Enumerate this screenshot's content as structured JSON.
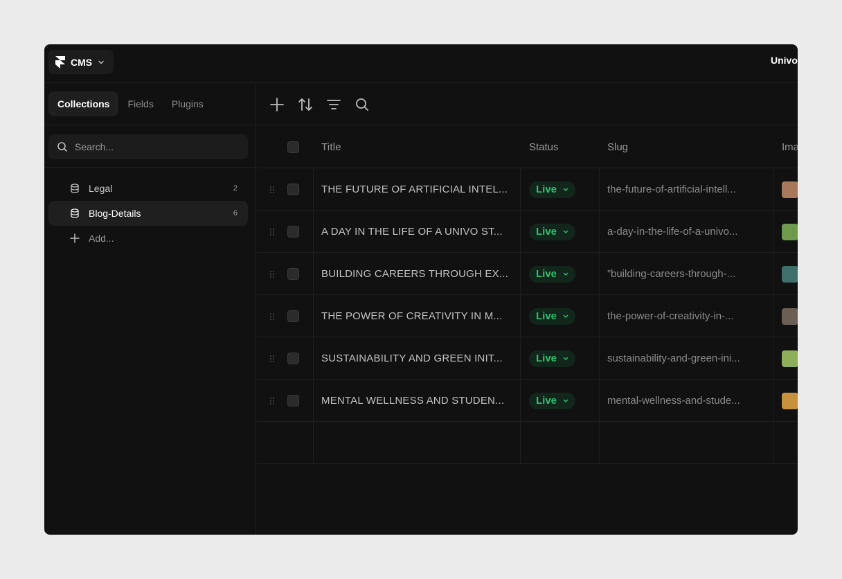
{
  "app": {
    "menu_label": "CMS",
    "project_name": "Univo"
  },
  "sidebar": {
    "tabs": [
      {
        "label": "Collections",
        "active": true
      },
      {
        "label": "Fields",
        "active": false
      },
      {
        "label": "Plugins",
        "active": false
      }
    ],
    "search_placeholder": "Search...",
    "collections": [
      {
        "label": "Legal",
        "count": "2",
        "active": false
      },
      {
        "label": "Blog-Details",
        "count": "6",
        "active": true
      }
    ],
    "add_label": "Add..."
  },
  "toolbar": {
    "icons": [
      "plus-icon",
      "sort-icon",
      "filter-icon",
      "search-icon"
    ]
  },
  "table": {
    "columns": [
      "Title",
      "Status",
      "Slug",
      "Image"
    ],
    "rows": [
      {
        "title": "THE FUTURE OF ARTIFICIAL INTEL...",
        "status": "Live",
        "slug": "the-future-of-artificial-intell...",
        "thumb_color": "#a7795a"
      },
      {
        "title": "A DAY IN THE LIFE OF A UNIVO ST...",
        "status": "Live",
        "slug": "a-day-in-the-life-of-a-univo...",
        "thumb_color": "#6f9a4e"
      },
      {
        "title": "BUILDING CAREERS THROUGH EX...",
        "status": "Live",
        "slug": "”building-careers-through-...",
        "thumb_color": "#3f6f6a"
      },
      {
        "title": "THE POWER OF CREATIVITY IN M...",
        "status": "Live",
        "slug": "the-power-of-creativity-in-...",
        "thumb_color": "#6b5e55"
      },
      {
        "title": "SUSTAINABILITY AND GREEN INIT...",
        "status": "Live",
        "slug": "sustainability-and-green-ini...",
        "thumb_color": "#8fae5a"
      },
      {
        "title": "MENTAL WELLNESS AND STUDEN...",
        "status": "Live",
        "slug": "mental-wellness-and-stude...",
        "thumb_color": "#c8913d"
      }
    ]
  },
  "colors": {
    "background": "#111111",
    "live_green": "#2fbf71"
  }
}
